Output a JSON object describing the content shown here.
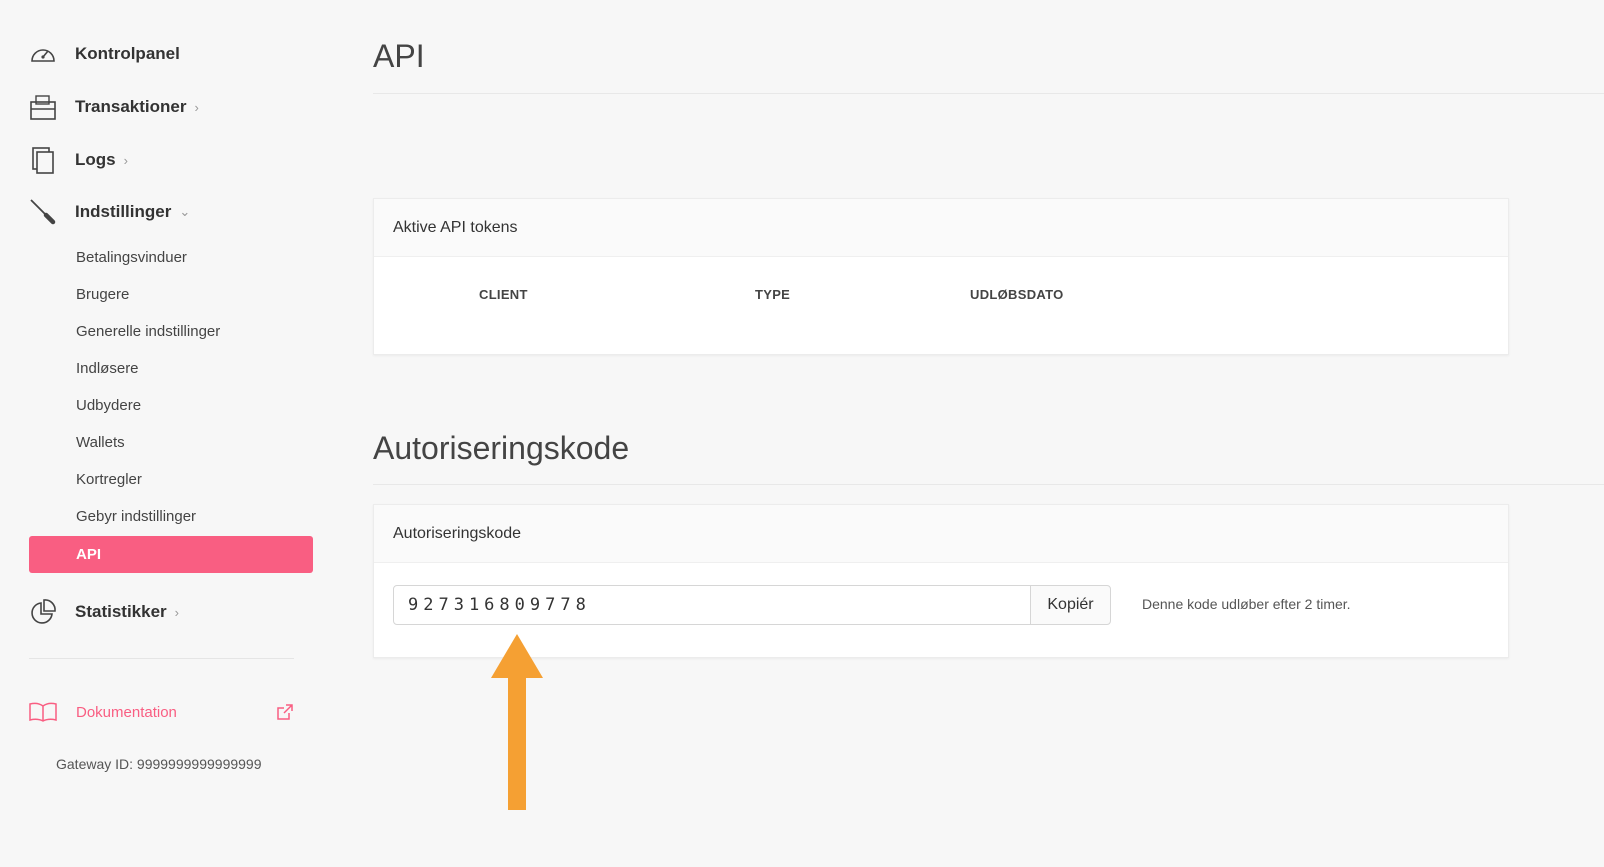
{
  "sidebar": {
    "nav": [
      {
        "label": "Kontrolpanel",
        "icon": "dashboard-gauge-icon"
      },
      {
        "label": "Transaktioner",
        "icon": "wallet-icon",
        "chevron": "›"
      },
      {
        "label": "Logs",
        "icon": "documents-icon",
        "chevron": "›"
      },
      {
        "label": "Indstillinger",
        "icon": "screwdriver-icon",
        "chevron": "⌄"
      },
      {
        "label": "Statistikker",
        "icon": "pie-chart-icon",
        "chevron": "›"
      }
    ],
    "settings_items": [
      "Betalingsvinduer",
      "Brugere",
      "Generelle indstillinger",
      "Indløsere",
      "Udbydere",
      "Wallets",
      "Kortregler",
      "Gebyr indstillinger",
      "API"
    ],
    "active_item": "API",
    "documentation_label": "Dokumentation",
    "gateway_id": "Gateway ID: 9999999999999999"
  },
  "main": {
    "title": "API",
    "tokens_card": {
      "header": "Aktive API tokens",
      "columns": [
        "CLIENT",
        "TYPE",
        "UDLØBSDATO"
      ],
      "rows": []
    },
    "auth_section_title": "Autoriseringskode",
    "auth_card": {
      "header": "Autoriseringskode",
      "code": "927316809778",
      "copy_label": "Kopiér",
      "note": "Denne kode udløber efter 2 timer."
    }
  },
  "colors": {
    "accent": "#f95e82",
    "arrow": "#f5a033",
    "background": "#f7f7f7"
  }
}
